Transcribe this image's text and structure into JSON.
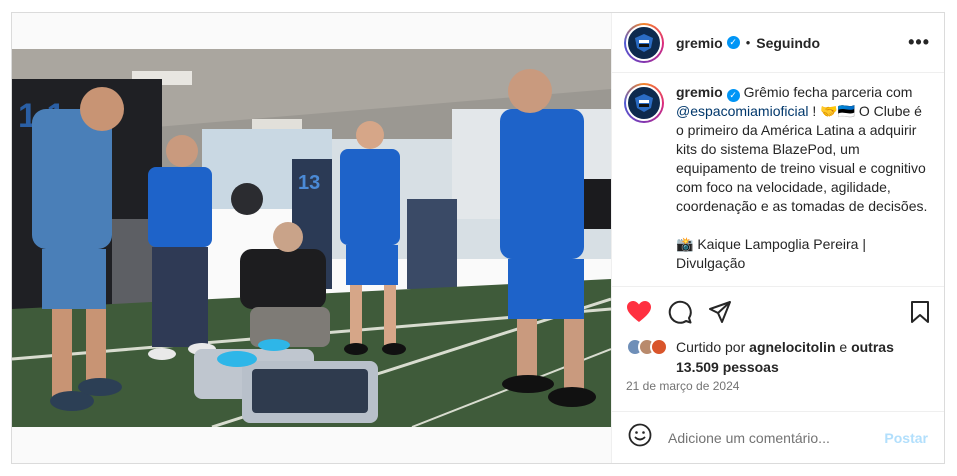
{
  "header": {
    "username": "gremio",
    "separator": "•",
    "follow_status": "Seguindo",
    "more_glyph": "•••"
  },
  "caption": {
    "username": "gremio",
    "text_1": "Grêmio fecha parceria com ",
    "mention": "@espacomiamioficial",
    "text_2": " ! 🤝🇪🇪 O Clube é o primeiro da América Latina a adquirir kits do sistema BlazePod, um equipamento de treino visual e cognitivo com foco na velocidade, agilidade, coordenação e as tomadas de decisões.",
    "credit": "📸 Kaique Lampoglia Pereira | Divulgação"
  },
  "likes": {
    "prefix": "Curtido por ",
    "user": "agnelocitolin",
    "middle": " e ",
    "others": "outras 13.509 pessoas"
  },
  "date": "21 de março de 2024",
  "comment_box": {
    "placeholder": "Adicione um comentário...",
    "post_label": "Postar"
  },
  "colors": {
    "like_red": "#ff3040",
    "verified_blue": "#0095f6",
    "mention_blue": "#00376b",
    "post_disabled": "#b2dffc",
    "gremio_navy": "#0d2a4e",
    "gremio_blue": "#2b6cc4"
  },
  "icons": [
    "heart-icon",
    "comment-icon",
    "share-icon",
    "bookmark-icon",
    "emoji-icon",
    "verified-icon",
    "more-options-icon"
  ]
}
